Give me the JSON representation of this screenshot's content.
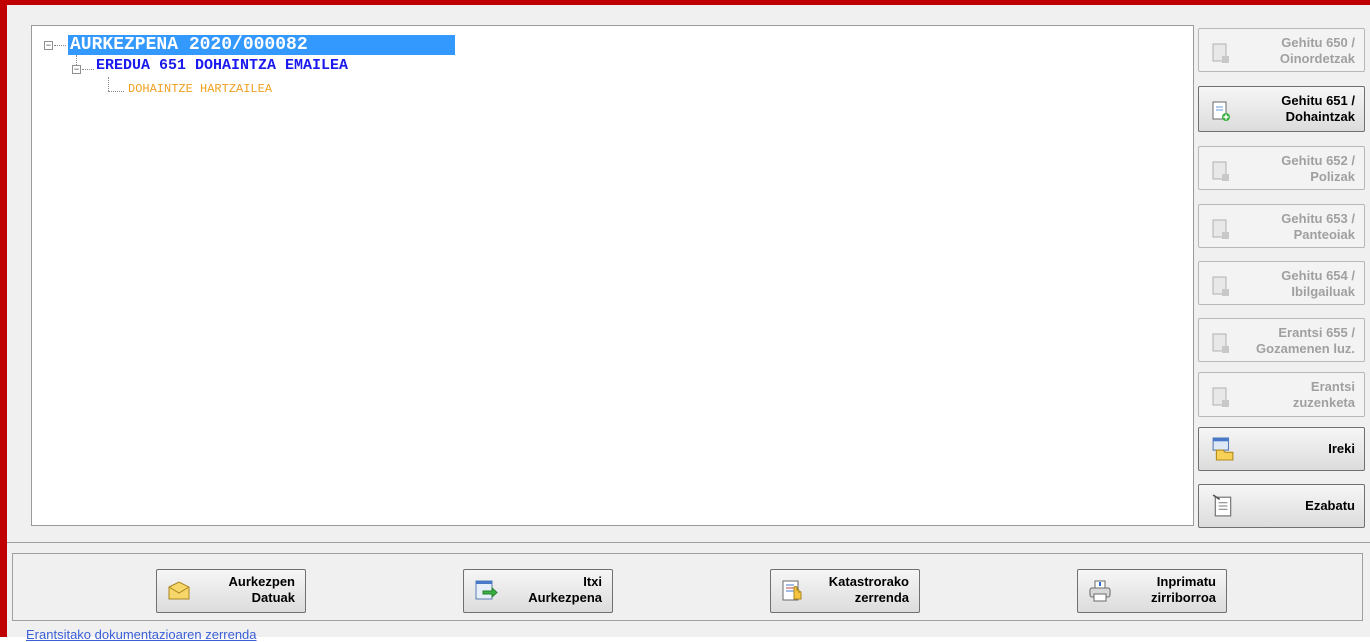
{
  "tree": {
    "root": {
      "label": "AURKEZPENA 2020/000082",
      "expander": "⊟"
    },
    "child": {
      "label": "EREDUA 651 DOHAINTZA EMAILEA",
      "expander": "⊟"
    },
    "leaf": {
      "label": "DOHAINTZE HARTZAILEA"
    }
  },
  "side_buttons": [
    {
      "line1": "Gehitu 650 /",
      "line2": "Oinordetzak",
      "enabled": false,
      "icon": "document-add-icon"
    },
    {
      "line1": "Gehitu 651 /",
      "line2": "Dohaintzak",
      "enabled": true,
      "icon": "document-add-icon"
    },
    {
      "line1": "Gehitu 652 /",
      "line2": "Polizak",
      "enabled": false,
      "icon": "document-add-icon"
    },
    {
      "line1": "Gehitu 653 /",
      "line2": "Panteoiak",
      "enabled": false,
      "icon": "document-add-icon"
    },
    {
      "line1": "Gehitu 654 /",
      "line2": "Ibilgailuak",
      "enabled": false,
      "icon": "document-add-icon"
    },
    {
      "line1": "Erantsi 655 /",
      "line2": "Gozamenen luz.",
      "enabled": false,
      "icon": "document-add-icon"
    },
    {
      "line1": "Erantsi",
      "line2": "zuzenketa",
      "enabled": false,
      "icon": "document-add-icon"
    },
    {
      "line1": "Ireki",
      "line2": "",
      "enabled": true,
      "icon": "open-folder-icon"
    },
    {
      "line1": "Ezabatu",
      "line2": "",
      "enabled": true,
      "icon": "delete-document-icon"
    }
  ],
  "bottom_buttons": [
    {
      "line1": "Aurkezpen",
      "line2": "Datuak",
      "icon": "envelope-icon"
    },
    {
      "line1": "Itxi",
      "line2": "Aurkezpena",
      "icon": "close-window-icon"
    },
    {
      "line1": "Katastrorako",
      "line2": "zerrenda",
      "icon": "list-hand-icon"
    },
    {
      "line1": "Inprimatu",
      "line2": "zirriborroa",
      "icon": "printer-icon"
    }
  ],
  "footer": {
    "link": "Erantsitako dokumentazioaren zerrenda"
  },
  "colors": {
    "selection": "#3399ff",
    "child_text": "#1a1aee",
    "leaf_text": "#f0a020",
    "frame": "#c00000"
  }
}
